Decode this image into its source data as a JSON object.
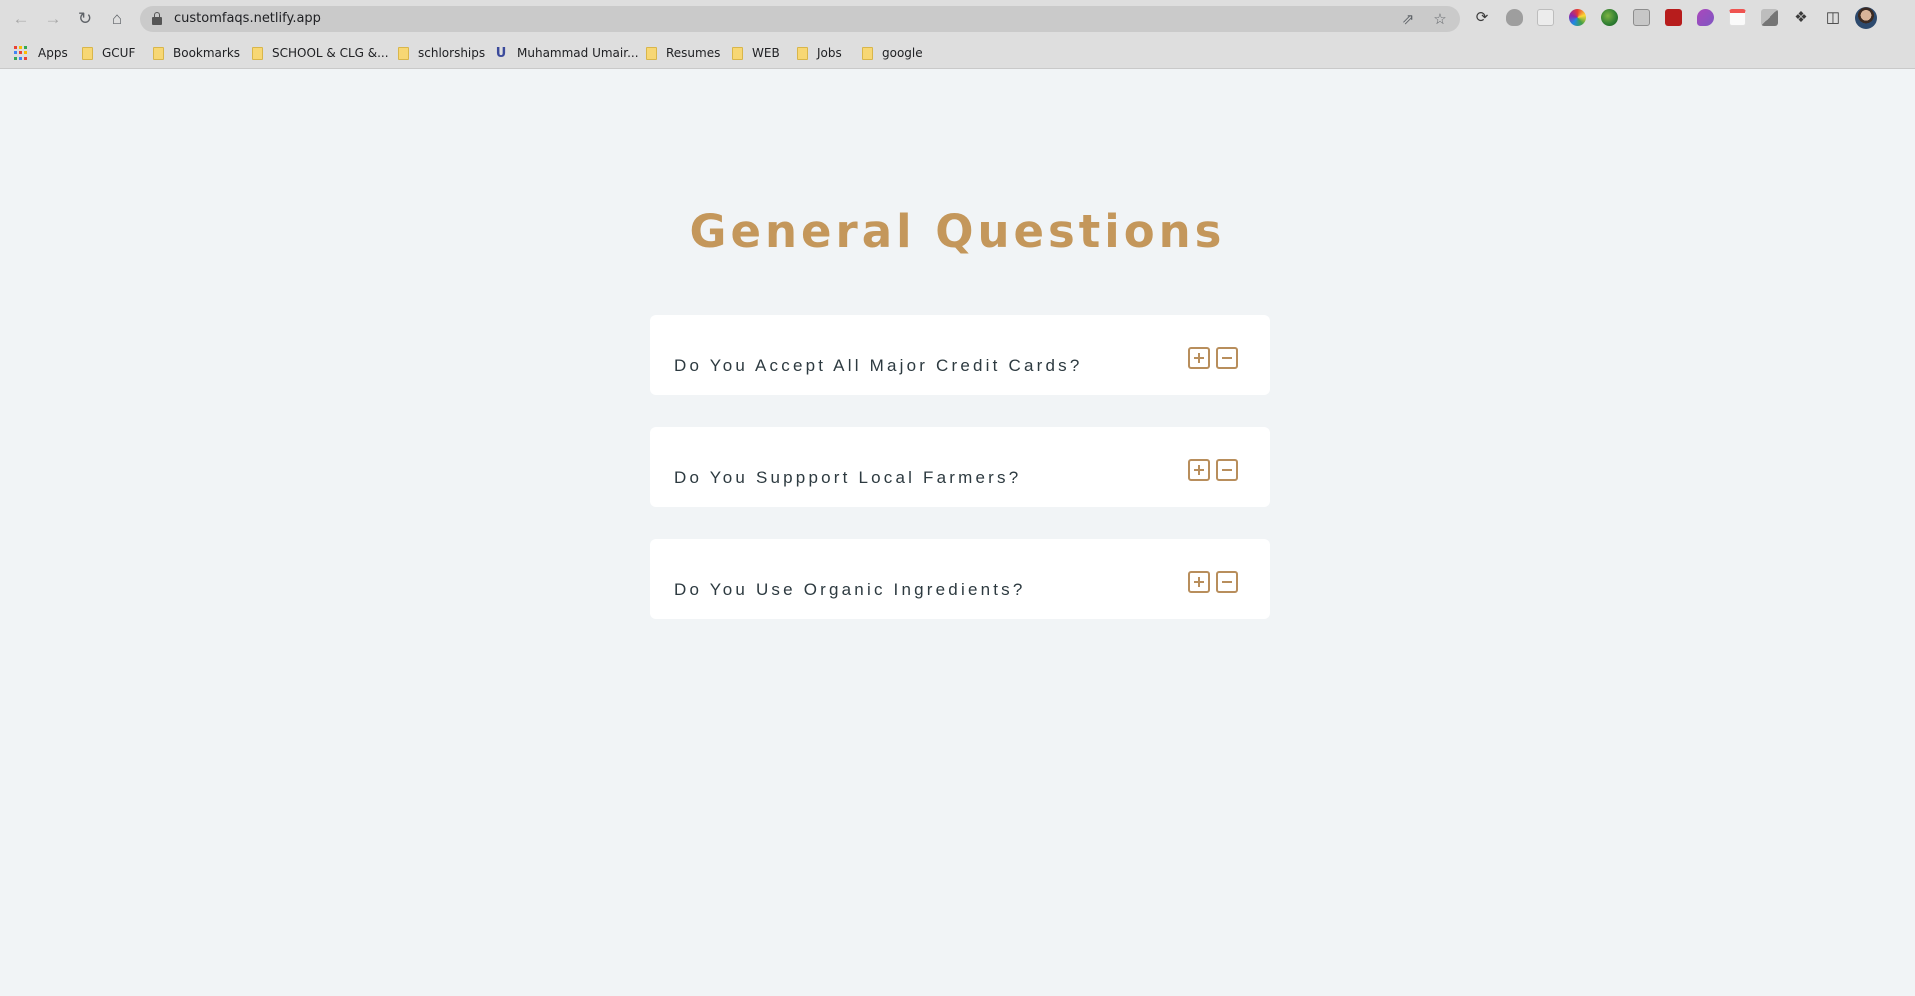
{
  "browser": {
    "url": "customfaqs.netlify.app",
    "bookmarks": [
      {
        "label": "Apps",
        "icon": "apps-grid-icon"
      },
      {
        "label": "GCUF",
        "icon": "folder-icon"
      },
      {
        "label": "Bookmarks",
        "icon": "folder-icon"
      },
      {
        "label": "SCHOOL & CLG &...",
        "icon": "folder-icon"
      },
      {
        "label": "schlorships",
        "icon": "folder-icon"
      },
      {
        "label": "Muhammad Umair...",
        "icon": "site-favicon-icon"
      },
      {
        "label": "Resumes",
        "icon": "folder-icon"
      },
      {
        "label": "WEB",
        "icon": "folder-icon"
      },
      {
        "label": "Jobs",
        "icon": "folder-icon"
      },
      {
        "label": "google",
        "icon": "folder-icon"
      }
    ]
  },
  "page": {
    "title": "General Questions",
    "faqs": [
      {
        "question": "Do You Accept All Major Credit Cards?"
      },
      {
        "question": "Do You Suppport Local Farmers?"
      },
      {
        "question": "Do You Use Organic Ingredients?"
      }
    ]
  },
  "colors": {
    "accent": "#c4975b",
    "background": "#f1f4f6",
    "card": "#ffffff",
    "question_text": "#2d3a40"
  }
}
